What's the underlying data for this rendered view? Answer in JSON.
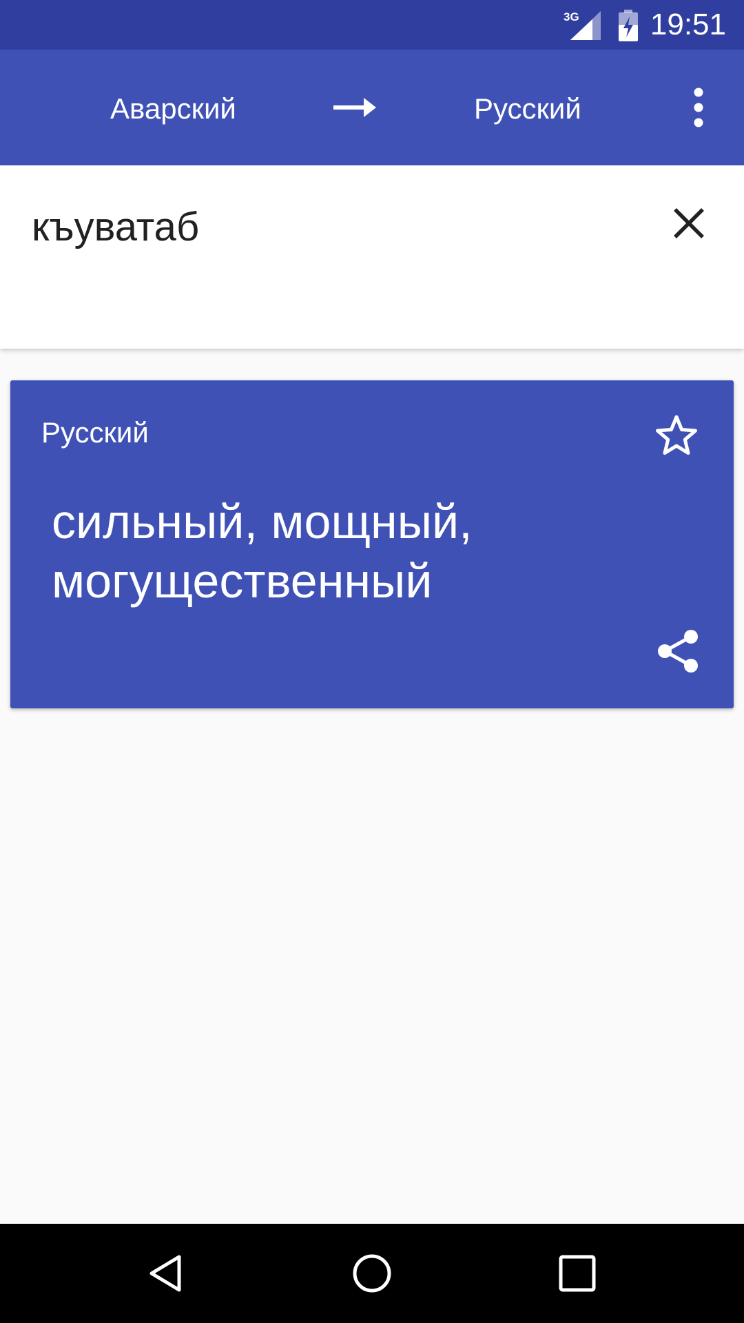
{
  "status_bar": {
    "network_label": "3G",
    "network_icon": "signal-icon",
    "battery_icon": "battery-charging-icon",
    "time": "19:51",
    "background": "#303f9f"
  },
  "app_bar": {
    "source_language": "Аварский",
    "swap_icon": "arrow-right-icon",
    "target_language": "Русский",
    "menu_icon": "more-vert-icon",
    "background": "#3f51b5"
  },
  "input": {
    "value": "къуватаб",
    "clear_icon": "close-icon"
  },
  "result_card": {
    "language": "Русский",
    "favorite_icon": "star-outline-icon",
    "translation": "сильный, мощный, могущественный",
    "share_icon": "share-icon",
    "background": "#3f51b5"
  },
  "nav_bar": {
    "back_icon": "back-icon",
    "home_icon": "home-icon",
    "recents_icon": "recents-icon"
  }
}
